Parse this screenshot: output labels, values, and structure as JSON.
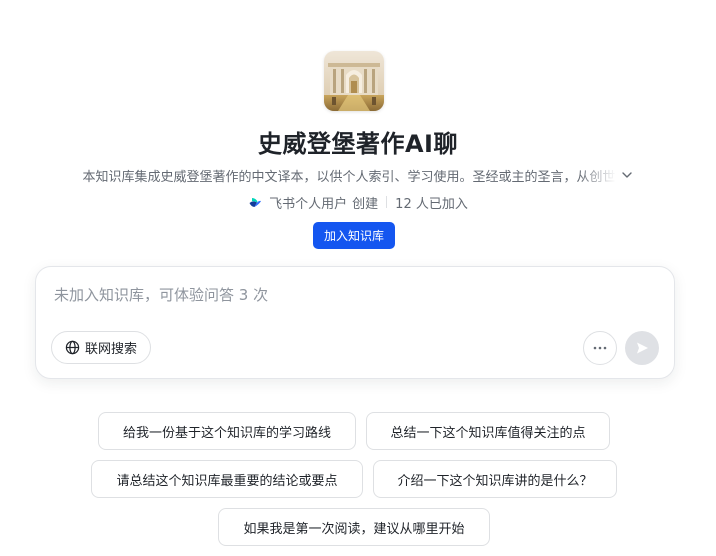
{
  "knowledge_base": {
    "title": "史威登堡著作AI聊",
    "description": "本知识库集成史威登堡著作的中文译本，以供个人索引、学习使用。圣经或主的圣言，从创世",
    "creator_icon": "feishu-logo-icon",
    "creator": "飞书个人用户",
    "created_label": "创建",
    "members": "12 人已加入",
    "join_label": "加入知识库",
    "expand_icon": "chevron-down-icon"
  },
  "chat": {
    "placeholder": "未加入知识库，可体验问答 3 次",
    "web_search_label": "联网搜索",
    "web_search_icon": "globe-icon",
    "more_icon": "more-horizontal-icon",
    "send_icon": "send-icon"
  },
  "suggestions": [
    "给我一份基于这个知识库的学习路线",
    "总结一下这个知识库值得关注的点",
    "请总结这个知识库最重要的结论或要点",
    "介绍一下这个知识库讲的是什么？",
    "如果我是第一次阅读，建议从哪里开始"
  ],
  "colors": {
    "primary": "#1456f0",
    "text": "#1f2329",
    "secondary_text": "#646a73",
    "border": "#dee0e3"
  }
}
